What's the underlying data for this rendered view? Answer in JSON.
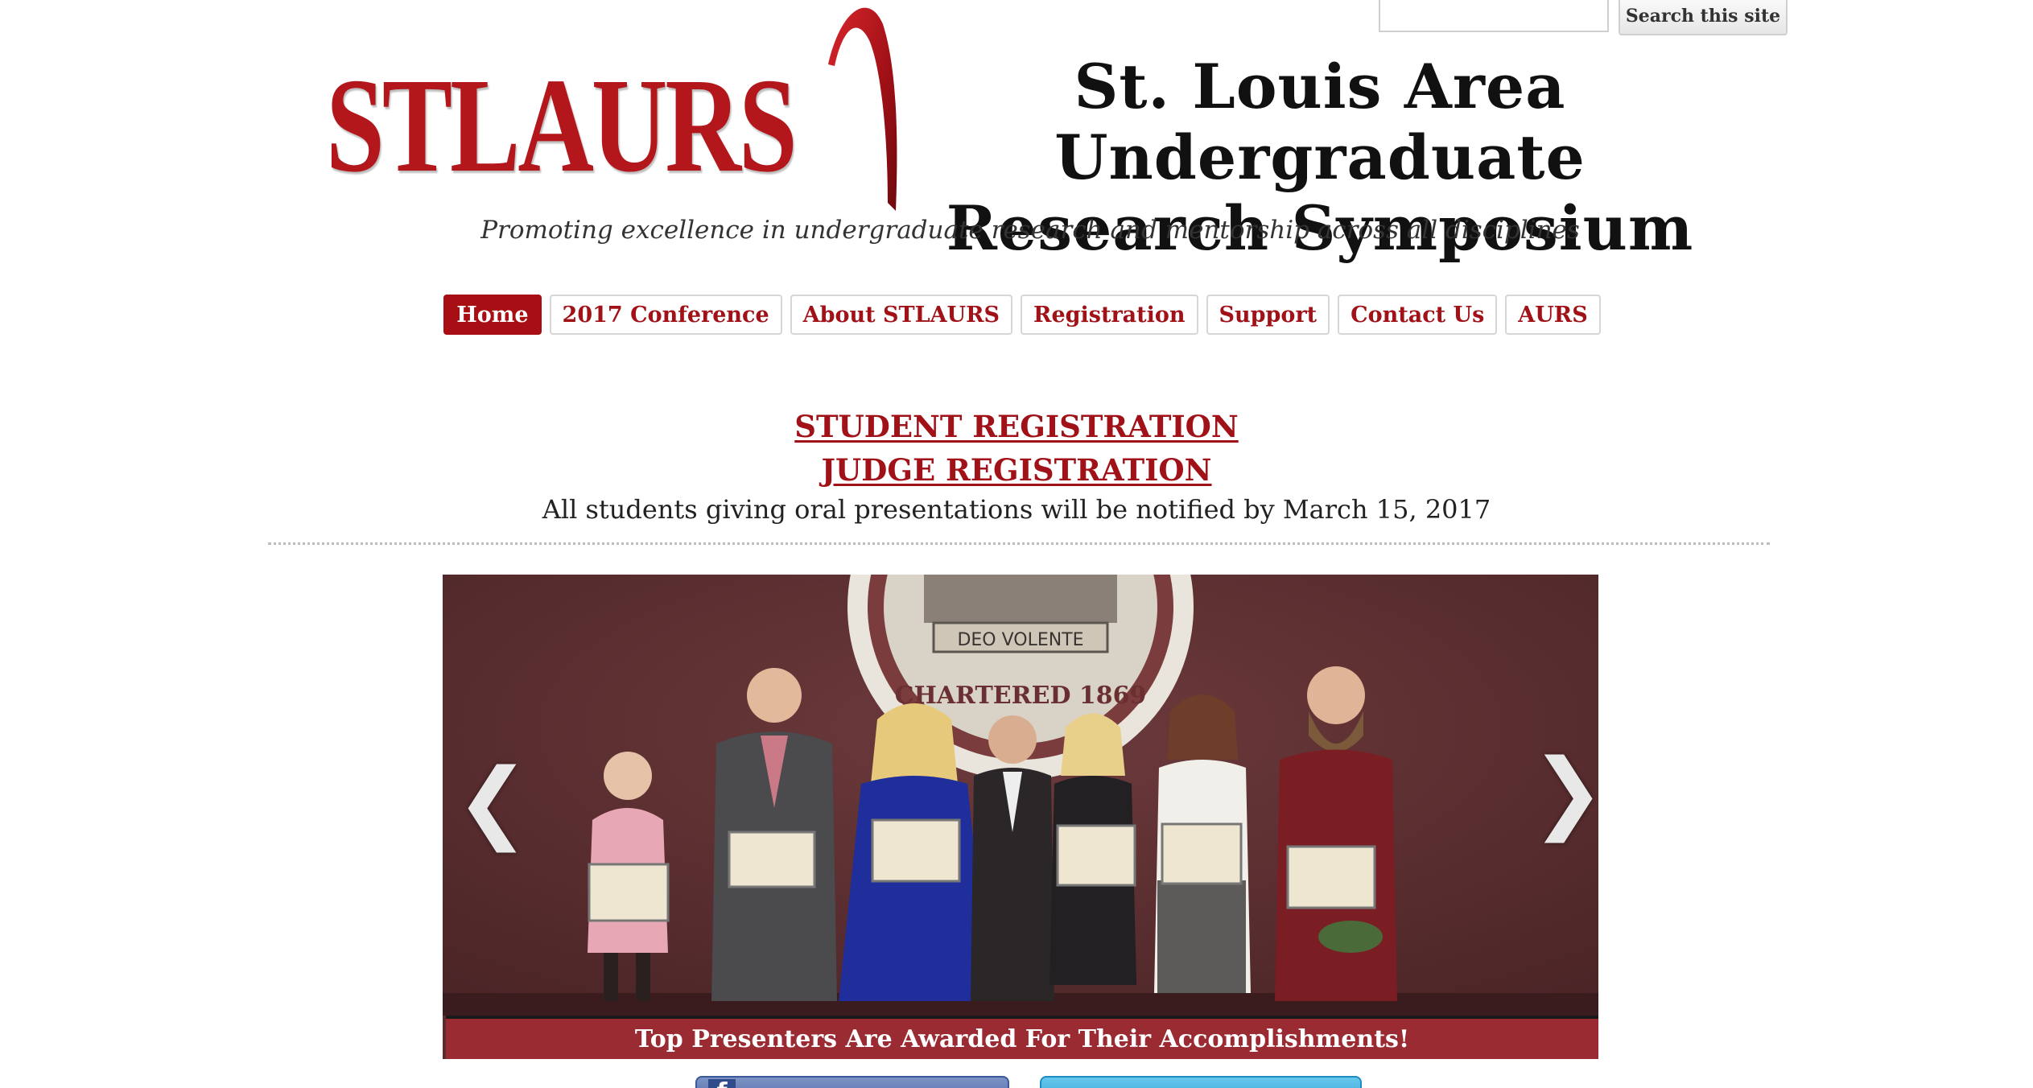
{
  "search": {
    "input_value": "",
    "placeholder": "",
    "button_label": "Search this site"
  },
  "header": {
    "logo_text": "STLAURS",
    "title_line1": "St. Louis Area Undergraduate",
    "title_line2": "Research Symposium",
    "tagline": "Promoting excellence in undergraduate research and mentorship across all disciplines"
  },
  "nav": {
    "items": [
      {
        "label": "Home",
        "active": true
      },
      {
        "label": "2017 Conference",
        "active": false
      },
      {
        "label": "About STLAURS",
        "active": false
      },
      {
        "label": "Registration",
        "active": false
      },
      {
        "label": "Support",
        "active": false
      },
      {
        "label": "Contact Us",
        "active": false
      },
      {
        "label": "AURS",
        "active": false
      }
    ]
  },
  "announcements": {
    "student_registration": "STUDENT REGISTRATION",
    "judge_registration": "JUDGE REGISTRATION",
    "notice": "All students giving oral presentations will be notified by March 15, 2017"
  },
  "slider": {
    "caption": "Top Presenters Are Awarded For Their Accomplishments!",
    "prev_glyph": "❮",
    "next_glyph": "❯",
    "photo_seal_text": "DEO VOLENTE",
    "photo_seal_ring": "CHARTERED 1869"
  },
  "social": {
    "facebook_glyph": "f"
  },
  "colors": {
    "brand_red": "#a80f14",
    "nav_text": "#a01218",
    "caption_bg": "#9b2b32",
    "photo_wall": "#5a2e30"
  }
}
